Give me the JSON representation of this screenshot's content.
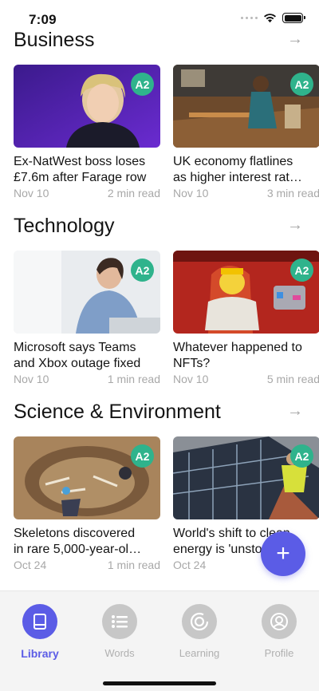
{
  "status_bar": {
    "time": "7:09"
  },
  "sections": [
    {
      "title": "Business",
      "arrow": "→",
      "articles": [
        {
          "title_line1": "Ex-NatWest boss loses",
          "title_line2": "£7.6m after Farage row",
          "date": "Nov 10",
          "read_time": "2 min read",
          "level": "A2"
        },
        {
          "title_line1": "UK economy flatlines",
          "title_line2": "as higher interest rat…",
          "date": "Nov 10",
          "read_time": "3 min read",
          "level": "A2"
        }
      ]
    },
    {
      "title": "Technology",
      "arrow": "→",
      "articles": [
        {
          "title_line1": "Microsoft says Teams",
          "title_line2": "and Xbox outage fixed",
          "date": "Nov 10",
          "read_time": "1 min read",
          "level": "A2"
        },
        {
          "title_line1": "Whatever happened to",
          "title_line2": "NFTs?",
          "date": "Nov 10",
          "read_time": "5 min read",
          "level": "A2"
        }
      ]
    },
    {
      "title": "Science & Environment",
      "arrow": "→",
      "articles": [
        {
          "title_line1": "Skeletons discovered",
          "title_line2": "in rare 5,000-year-ol…",
          "date": "Oct 24",
          "read_time": "1 min read",
          "level": "A2"
        },
        {
          "title_line1": "World's shift to clean",
          "title_line2": "energy is 'unstoppable'",
          "date": "Oct 24",
          "read_time": "",
          "level": "A2"
        }
      ]
    }
  ],
  "fab": {
    "icon": "plus-icon",
    "label": "+"
  },
  "tabs": [
    {
      "label": "Library",
      "icon": "book-icon",
      "active": true
    },
    {
      "label": "Words",
      "icon": "list-icon",
      "active": false
    },
    {
      "label": "Learning",
      "icon": "progress-ring-icon",
      "active": false
    },
    {
      "label": "Profile",
      "icon": "user-icon",
      "active": false
    }
  ],
  "colors": {
    "accent": "#5b5ce6",
    "level_badge": "#2fb38c",
    "muted": "#a8a8a8",
    "tab_bar": "#f4f4f4"
  }
}
